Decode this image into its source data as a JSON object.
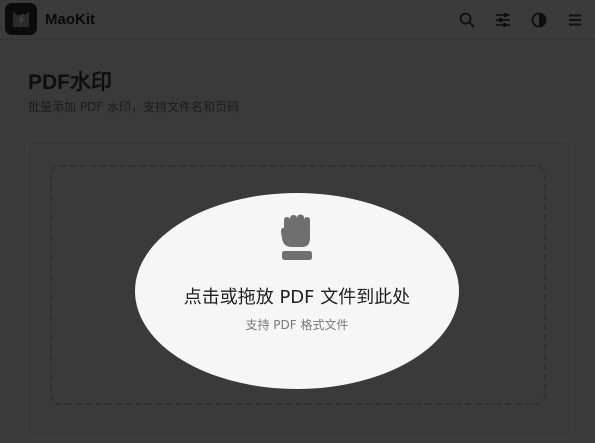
{
  "header": {
    "brand": "MaoKit",
    "icons": [
      "logo-icon",
      "search-icon",
      "sliders-icon",
      "theme-toggle-icon",
      "menu-icon"
    ]
  },
  "page": {
    "title": "PDF水印",
    "subtitle": "批量添加 PDF 水印，支持文件名和页码"
  },
  "dropzone": {
    "icon": "fist-icon",
    "title": "点击或拖放 PDF 文件到此处",
    "hint": "支持 PDF 格式文件"
  },
  "colors": {
    "overlay_background": "#3a3a3a",
    "spotlight": "#f6f6f6",
    "icon_gray": "#6f6f6f"
  }
}
